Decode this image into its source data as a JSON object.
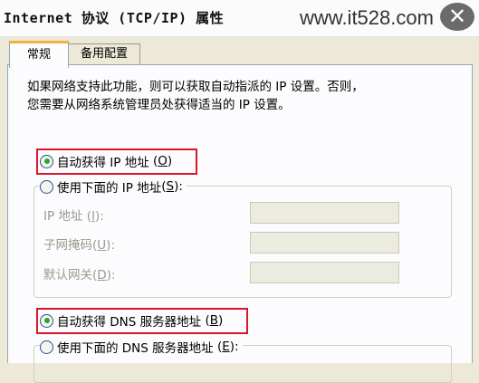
{
  "window": {
    "title": "Internet 协议 (TCP/IP) 属性",
    "watermark": "www.it528.com",
    "close_symbol": "✕"
  },
  "tabs": [
    {
      "label": "常规",
      "active": true
    },
    {
      "label": "备用配置",
      "active": false
    }
  ],
  "description": {
    "line1": "如果网络支持此功能，则可以获取自动指派的 IP 设置。否则，",
    "line2": "您需要从网络系统管理员处获得适当的 IP 设置。"
  },
  "ip": {
    "auto": {
      "label": "自动获得 IP 地址",
      "hotkey": "O",
      "selected": true
    },
    "manual": {
      "label": "使用下面的 IP 地址",
      "hotkey": "S",
      "selected": false
    },
    "fields": [
      {
        "label": "IP 地址",
        "hotkey": "I",
        "value": ""
      },
      {
        "label": "子网掩码",
        "hotkey": "U",
        "value": ""
      },
      {
        "label": "默认网关",
        "hotkey": "D",
        "value": ""
      }
    ]
  },
  "dns": {
    "auto": {
      "label": "自动获得 DNS 服务器地址",
      "hotkey": "B",
      "selected": true
    },
    "manual": {
      "label": "使用下面的 DNS 服务器地址",
      "hotkey": "E",
      "selected": false
    }
  },
  "colors": {
    "highlight_box": "#d8162a",
    "tab_accent": "#f0b43c",
    "radio_dot": "#2aa82a"
  }
}
